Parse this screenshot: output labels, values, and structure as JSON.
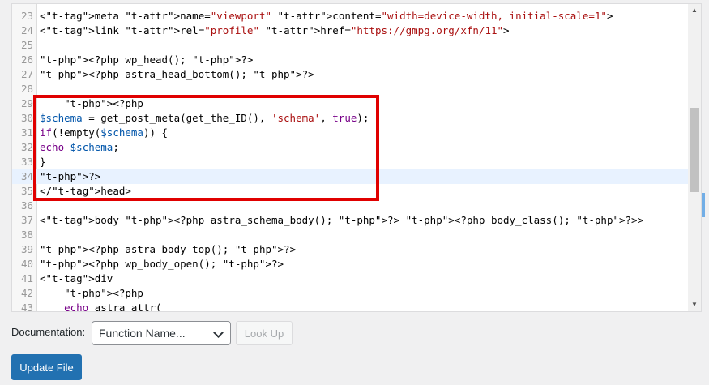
{
  "editor": {
    "lines": [
      {
        "n": "23",
        "code": "<meta name=\"viewport\" content=\"width=device-width, initial-scale=1\">"
      },
      {
        "n": "24",
        "code": "<link rel=\"profile\" href=\"https://gmpg.org/xfn/11\">"
      },
      {
        "n": "25",
        "code": ""
      },
      {
        "n": "26",
        "code": "<?php wp_head(); ?>"
      },
      {
        "n": "27",
        "code": "<?php astra_head_bottom(); ?>"
      },
      {
        "n": "28",
        "code": ""
      },
      {
        "n": "29",
        "code": "    <?php"
      },
      {
        "n": "30",
        "code": "$schema = get_post_meta(get_the_ID(), 'schema', true);"
      },
      {
        "n": "31",
        "code": "if(!empty($schema)) {"
      },
      {
        "n": "32",
        "code": "echo $schema;"
      },
      {
        "n": "33",
        "code": "}"
      },
      {
        "n": "34",
        "code": "?>"
      },
      {
        "n": "35",
        "code": "</head>"
      },
      {
        "n": "36",
        "code": ""
      },
      {
        "n": "37",
        "code": "<body <?php astra_schema_body(); ?> <?php body_class(); ?>>"
      },
      {
        "n": "38",
        "code": ""
      },
      {
        "n": "39",
        "code": "<?php astra_body_top(); ?>"
      },
      {
        "n": "40",
        "code": "<?php wp_body_open(); ?>"
      },
      {
        "n": "41",
        "code": "<div"
      },
      {
        "n": "42",
        "code": "    <?php"
      },
      {
        "n": "43",
        "code": "    echo astra_attr("
      }
    ],
    "active_line": "34",
    "highlighted_range": [
      "29",
      "35"
    ]
  },
  "documentation": {
    "label": "Documentation:",
    "select_value": "Function Name...",
    "lookup_label": "Look Up"
  },
  "update_button": "Update File",
  "colors": {
    "highlight_border": "#e00000",
    "primary_button": "#2271b1",
    "active_line_bg": "#e8f2ff"
  }
}
